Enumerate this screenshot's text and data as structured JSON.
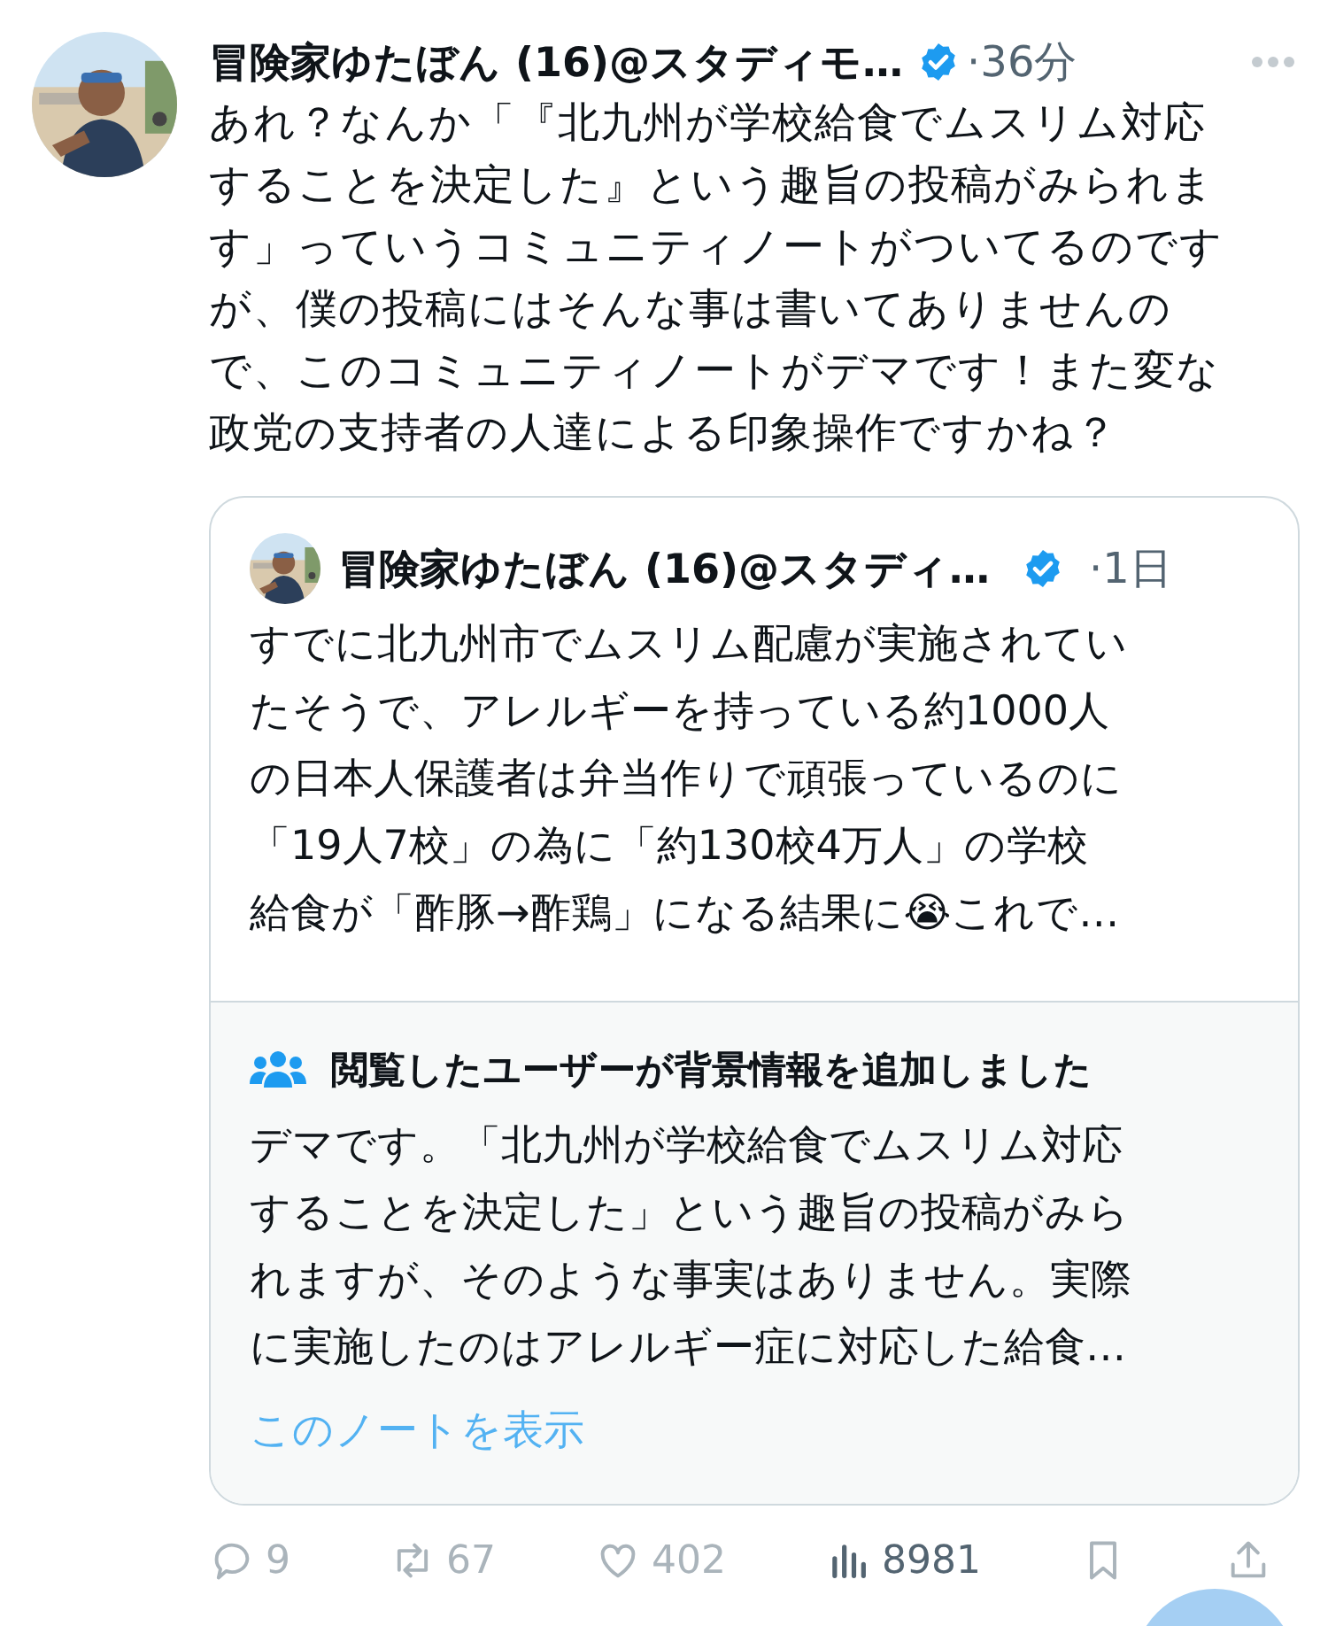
{
  "tweet": {
    "author": {
      "name": "冒険家ゆたぼん (16)@スタディモ…",
      "time": "·36分"
    },
    "text_lines": [
      "あれ？なんか「『北九州が学校給食でムスリム対応",
      "することを決定した』という趣旨の投稿がみられま",
      "す」っていうコミュニティノートがついてるのです",
      "が、僕の投稿にはそんな事は書いてありませんの",
      "で、このコミュニティノートがデマです！また変な",
      "政党の支持者の人達による印象操作ですかね？"
    ],
    "quote": {
      "author": {
        "name": "冒険家ゆたぼん (16)@スタディ…",
        "time": "·1日"
      },
      "text_lines": [
        "すでに北九州市でムスリム配慮が実施されてい",
        "たそうで、アレルギーを持っている約1000人",
        "の日本人保護者は弁当作りで頑張っているのに",
        "「19人7校」の為に「約130校4万人」の学校",
        "給食が「酢豚→酢鶏」になる結果に😭これで…"
      ]
    },
    "note": {
      "title": "閲覧したユーザーが背景情報を追加しました",
      "text_lines": [
        "デマです。「北九州が学校給食でムスリム対応",
        "することを決定した」という趣旨の投稿がみら",
        "れますが、そのような事実はありません。実際",
        "に実施したのはアレルギー症に対応した給食…"
      ],
      "link": "このノートを表示"
    },
    "actions": [
      {
        "kind": "reply",
        "count": "9",
        "dimmed": true
      },
      {
        "kind": "retweet",
        "count": "67",
        "dimmed": true
      },
      {
        "kind": "like",
        "count": "402",
        "dimmed": true
      },
      {
        "kind": "views",
        "count": "8981",
        "dimmed": false
      },
      {
        "kind": "bookmark",
        "dimmed": true
      },
      {
        "kind": "share",
        "dimmed": true
      }
    ]
  }
}
